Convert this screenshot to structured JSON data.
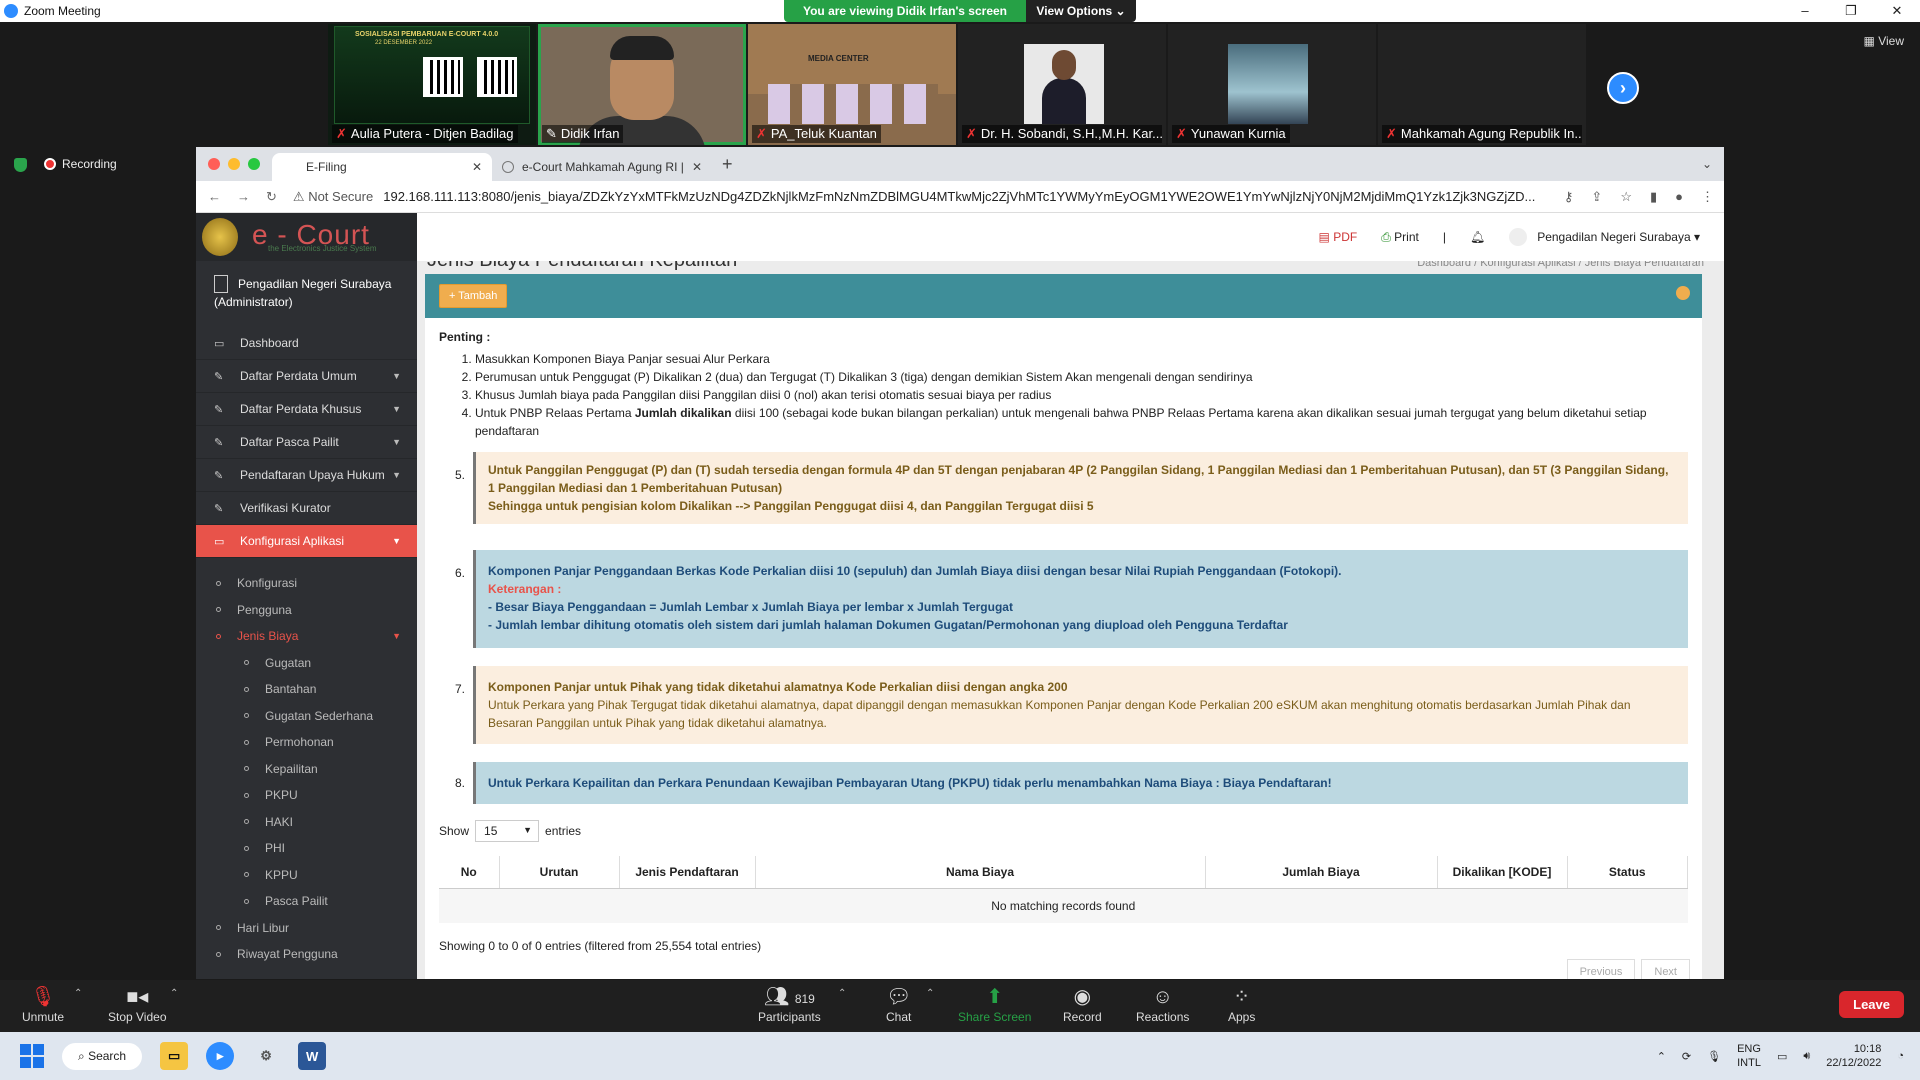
{
  "zoom": {
    "title": "Zoom Meeting",
    "win_controls": [
      "–",
      "❐",
      "✕"
    ],
    "banner_text": "You are viewing Didik Irfan's screen",
    "view_options": "View Options ⌄",
    "view_label": "▦ View",
    "recording": "Recording",
    "participants_count": "819",
    "toolbar": {
      "unmute": "Unmute",
      "stop_video": "Stop Video",
      "participants": "Participants",
      "chat": "Chat",
      "share_screen": "Share Screen",
      "record": "Record",
      "reactions": "Reactions",
      "apps": "Apps",
      "leave": "Leave"
    },
    "tiles": [
      {
        "name": "Aulia Putera - Ditjen Badilag",
        "poster_title": "SOSIALISASI PEMBARUAN E-COURT 4.0.0",
        "poster_date": "22 DESEMBER 2022"
      },
      {
        "name": "Didik Irfan"
      },
      {
        "name": "PA_Teluk Kuantan",
        "banner": "MEDIA CENTER"
      },
      {
        "name": "Dr. H. Sobandi, S.H.,M.H. Kar..."
      },
      {
        "name": "Yunawan Kurnia"
      },
      {
        "name": "Mahkamah Agung Republik In..."
      }
    ]
  },
  "browser": {
    "tabs": [
      {
        "label": "E-Filing"
      },
      {
        "label": "e-Court Mahkamah Agung RI |"
      }
    ],
    "not_secure": "Not Secure",
    "url": "192.168.111.113:8080/jenis_biaya/ZDZkYzYxMTFkMzUzNDg4ZDZkNjlkMzFmNzNmZDBlMGU4MTkwMjc2ZjVhMTc1YWMyYmEyOGM1YWE2OWE1YmYwNjlzNjY0NjM2MjdiMmQ1Yzk1Zjk3NGZjZD..."
  },
  "app": {
    "brand": "e - Court",
    "brand_sub": "the Electronics Justice System",
    "user_name": "Pengadilan Negeri Surabaya",
    "user_role": "(Administrator)",
    "topnav": {
      "pdf": "PDF",
      "print": "Print",
      "sep": "|",
      "account": "Pengadilan Negeri Surabaya ▾"
    },
    "page_title": "Jenis Biaya Pendaftaran Kepailitan",
    "breadcrumb": "Dashboard  /  Konfigurasi Aplikasi  /  Jenis Biaya Pendaftaran",
    "menu": [
      {
        "label": "Dashboard",
        "icon": "▭"
      },
      {
        "label": "Daftar Perdata Umum",
        "icon": "✎"
      },
      {
        "label": "Daftar Perdata Khusus",
        "icon": "✎"
      },
      {
        "label": "Daftar Pasca Pailit",
        "icon": "✎"
      },
      {
        "label": "Pendaftaran Upaya Hukum",
        "icon": "✎"
      },
      {
        "label": "Verifikasi Kurator",
        "icon": "✎"
      },
      {
        "label": "Konfigurasi Aplikasi",
        "icon": "▭"
      }
    ],
    "submenu": [
      "Konfigurasi",
      "Pengguna",
      "Jenis Biaya"
    ],
    "submenu2": [
      "Gugatan",
      "Bantahan",
      "Gugatan Sederhana",
      "Permohonan",
      "Kepailitan",
      "PKPU",
      "HAKI",
      "PHI",
      "KPPU",
      "Pasca Pailit"
    ],
    "submenu3": [
      "Hari Libur",
      "Riwayat Pengguna"
    ],
    "add_button": "+ Tambah",
    "penting": "Penting :",
    "notes": [
      "Masukkan Komponen Biaya Panjar sesuai Alur Perkara",
      "Perumusan untuk Penggugat (P) Dikalikan 2 (dua) dan Tergugat (T) Dikalikan 3 (tiga) dengan demikian Sistem Akan mengenali dengan sendirinya",
      "Khusus Jumlah biaya pada Panggilan diisi Panggilan diisi 0 (nol) akan terisi otomatis sesuai biaya per radius"
    ],
    "note4_a": "Untuk PNBP Relaas Pertama ",
    "note4_b": "Jumlah dikalikan",
    "note4_c": " diisi 100 (sebagai kode bukan bilangan perkalian) untuk mengenali bahwa PNBP Relaas Pertama karena akan dikalikan sesuai jumah tergugat yang belum diketahui setiap pendaftaran",
    "c5_num": "5.",
    "c5_a": "Untuk Panggilan Penggugat (P) dan (T) sudah tersedia dengan formula 4P dan 5T dengan penjabaran 4P (2 Panggilan Sidang, 1 Panggilan Mediasi dan 1 Pemberitahuan Putusan), dan 5T (3 Panggilan Sidang, 1 Panggilan Mediasi dan 1 Pemberitahuan Putusan)",
    "c5_b": "Sehingga untuk pengisian kolom Dikalikan --> Panggilan Penggugat diisi 4, dan Panggilan Tergugat diisi 5",
    "c6_num": "6.",
    "c6_a": "Komponen Panjar Penggandaan Berkas Kode Perkalian diisi 10 (sepuluh) dan Jumlah Biaya diisi dengan besar Nilai Rupiah Penggandaan (Fotokopi).",
    "c6_k": "Keterangan :",
    "c6_b": "- Besar Biaya Penggandaan = Jumlah Lembar x Jumlah Biaya per lembar x Jumlah Tergugat",
    "c6_c": "- Jumlah lembar dihitung otomatis oleh sistem dari jumlah halaman Dokumen Gugatan/Permohonan yang diupload oleh Pengguna Terdaftar",
    "c7_num": "7.",
    "c7_a": "Komponen Panjar untuk Pihak yang tidak diketahui alamatnya Kode Perkalian diisi dengan angka 200",
    "c7_b": "Untuk Perkara yang Pihak Tergugat tidak diketahui alamatnya, dapat dipanggil dengan memasukkan Komponen Panjar dengan Kode Perkalian 200 eSKUM akan menghitung otomatis berdasarkan Jumlah Pihak dan Besaran Panggilan untuk Pihak yang tidak diketahui alamatnya.",
    "c8_num": "8.",
    "c8_a": "Untuk Perkara Kepailitan dan Perkara Penundaan Kewajiban Pembayaran Utang (PKPU) tidak perlu menambahkan Nama Biaya : Biaya Pendaftaran!",
    "show": "Show",
    "show_value": "15",
    "entries": "entries",
    "columns": [
      "No",
      "Urutan",
      "Jenis Pendaftaran",
      "Nama Biaya",
      "Jumlah Biaya",
      "Dikalikan [KODE]",
      "Status"
    ],
    "empty": "No matching records found",
    "info": "Showing 0 to 0 of 0 entries (filtered from 25,554 total entries)",
    "prev": "Previous",
    "next": "Next"
  },
  "taskbar": {
    "search": "Search",
    "lang1": "ENG",
    "lang2": "INTL",
    "time": "10:18",
    "date": "22/12/2022"
  }
}
